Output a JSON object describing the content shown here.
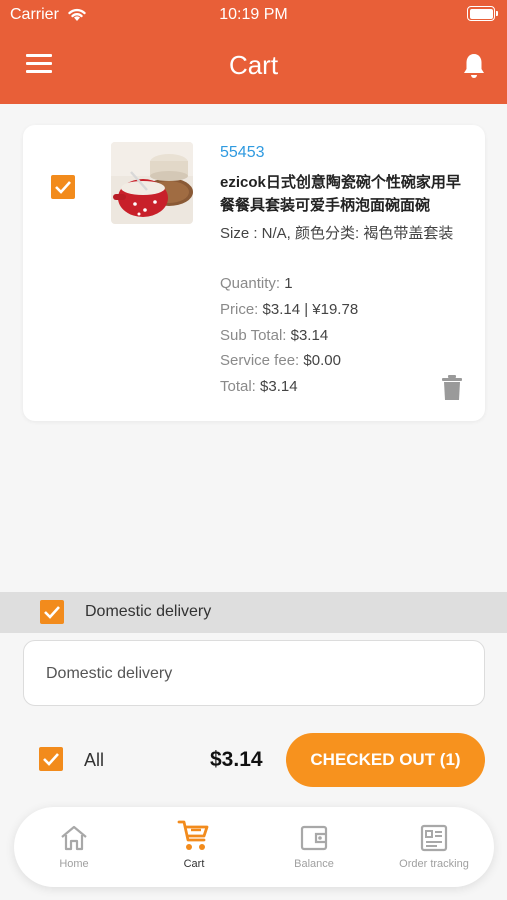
{
  "status_bar": {
    "carrier": "Carrier",
    "time": "10:19 PM"
  },
  "header": {
    "title": "Cart"
  },
  "item": {
    "id": "55453",
    "name": "ezicok日式创意陶瓷碗个性碗家用早餐餐具套装可爱手柄泡面碗面碗",
    "size": "Size : N/A, 颜色分类: 褐色带盖套装",
    "quantity_label": "Quantity:",
    "quantity": "1",
    "price_label": "Price:",
    "price": "$3.14 | ¥19.78",
    "subtotal_label": "Sub Total:",
    "subtotal": "$3.14",
    "service_fee_label": "Service fee:",
    "service_fee": "$0.00",
    "total_label": "Total:",
    "total": "$3.14"
  },
  "delivery": {
    "section_label": "Domestic delivery",
    "option_text": "Domestic delivery"
  },
  "footer": {
    "all_label": "All",
    "total": "$3.14",
    "checkout_label": "CHECKED OUT (1)"
  },
  "tabs": [
    {
      "label": "Home",
      "icon": "home-icon"
    },
    {
      "label": "Cart",
      "icon": "cart-icon"
    },
    {
      "label": "Balance",
      "icon": "wallet-icon"
    },
    {
      "label": "Order tracking",
      "icon": "order-tracking-icon"
    }
  ],
  "colors": {
    "header": "#e85f38",
    "accent": "#f7921e",
    "link": "#2f9ae0"
  }
}
